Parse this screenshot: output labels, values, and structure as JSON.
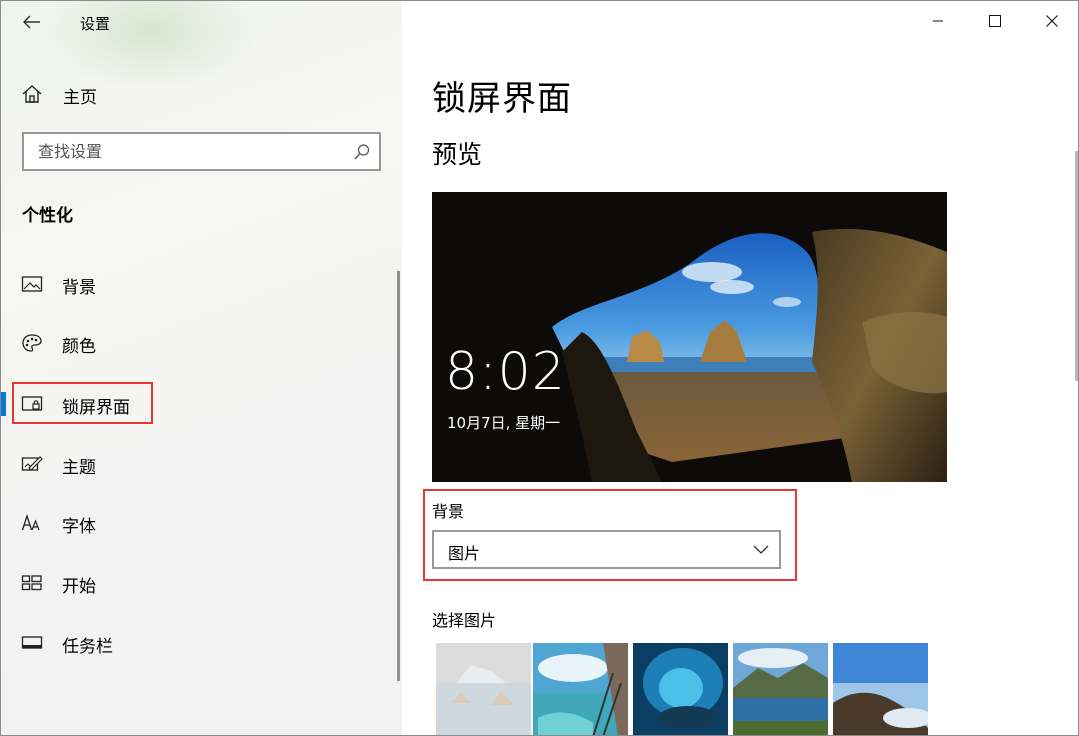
{
  "window": {
    "app_title": "设置",
    "colors": {
      "accent": "#0078d7",
      "highlight": "#e53935"
    }
  },
  "sidebar": {
    "home_label": "主页",
    "search_placeholder": "查找设置",
    "section_heading": "个性化",
    "items": [
      {
        "label": "背景",
        "icon": "picture-icon"
      },
      {
        "label": "颜色",
        "icon": "palette-icon"
      },
      {
        "label": "锁屏界面",
        "icon": "lock-screen-icon",
        "selected": true
      },
      {
        "label": "主题",
        "icon": "theme-icon"
      },
      {
        "label": "字体",
        "icon": "font-icon"
      },
      {
        "label": "开始",
        "icon": "start-icon"
      },
      {
        "label": "任务栏",
        "icon": "taskbar-icon"
      }
    ]
  },
  "main": {
    "page_title": "锁屏界面",
    "preview_heading": "预览",
    "preview": {
      "time": "8:02",
      "date": "10月7日, 星期一"
    },
    "background_label": "背景",
    "background_value": "图片",
    "choose_picture_label": "选择图片"
  }
}
